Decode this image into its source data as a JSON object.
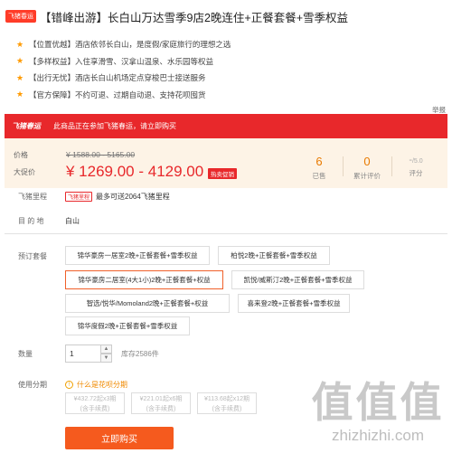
{
  "header": {
    "badge": "飞猪春运",
    "title": "【错峰出游】长白山万达雪季9店2晚连住+正餐套餐+雪季权益"
  },
  "features": [
    "【位置优越】酒店依邻长白山，是度假/家庭旅行的理想之选",
    "【多样权益】入住享滑雪、汉拿山温泉、水乐园等权益",
    "【出行无忧】酒店长白山机场定点穿梭巴士接送服务",
    "【官方保障】不约可退、过期自动退、支持花呗囤货"
  ],
  "report_label": "举报",
  "promo": {
    "logo": "飞猪春运",
    "text": "此商品正在参加飞猪春运，请立即购买"
  },
  "price": {
    "label": "价格",
    "old": "¥ 1588.00 - 5165.00",
    "promo_label": "大促价",
    "new": "¥ 1269.00 - 4129.00",
    "hot_badge": "热卖促销"
  },
  "stats": {
    "sold_num": "6",
    "sold_label": "已售",
    "reviews_num": "0",
    "reviews_label": "累计评价",
    "score_num": "-",
    "score_max": "/5.0",
    "score_label": "评分"
  },
  "mileage": {
    "label": "飞猪里程",
    "badge": "飞猪里程",
    "text": "最多可送2064飞猪里程"
  },
  "destination": {
    "label": "目 的 地",
    "value": "白山"
  },
  "packages": {
    "label": "预订套餐",
    "items": [
      "锦华豪房一居室2晚+正餐套餐+雪季权益",
      "柏悦2晚+正餐套餐+雪季权益",
      "锦华豪房二居室(4大1小)2晚+正餐套餐+权益",
      "凯悦/威斯汀2晚+正餐套餐+雪季权益",
      "智选/悦华/Momoland2晚+正餐套餐+权益",
      "喜来登2晚+正餐套餐+雪季权益",
      "锦华度假2晚+正餐套餐+雪季权益"
    ],
    "selected_index": 2
  },
  "quantity": {
    "label": "数量",
    "value": "1",
    "stock": "库存2586件",
    "up": "▲",
    "down": "▼"
  },
  "installments": {
    "label": "使用分期",
    "help": "什么是花呗分期",
    "help_icon": "!",
    "options": [
      {
        "line1": "¥432.72起x3期",
        "line2": "(含手续费)"
      },
      {
        "line1": "¥221.01起x6期",
        "line2": "(含手续费)"
      },
      {
        "line1": "¥113.68起x12期",
        "line2": "(含手续费)"
      }
    ]
  },
  "buy_button": "立即购买",
  "watermark": {
    "logo": "值值值",
    "url": "zhizhizhi.com"
  },
  "colors": {
    "brand_red": "#e8282b",
    "accent_orange": "#f55a1e",
    "price_bg": "#fdf3e6"
  }
}
